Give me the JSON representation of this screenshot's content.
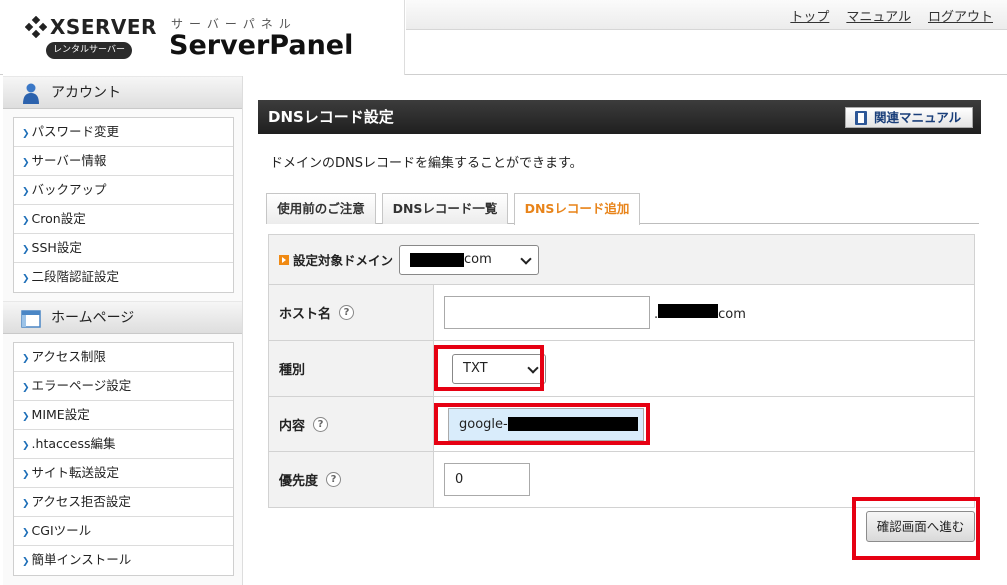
{
  "header": {
    "brand": "XSERVER",
    "rental_badge": "レンタルサーバー",
    "panel_kana": "サーバーパネル",
    "panel_name": "ServerPanel",
    "links": [
      "トップ",
      "マニュアル",
      "ログアウト"
    ]
  },
  "sidebar": {
    "sections": [
      {
        "title": "アカウント",
        "icon": "user-icon",
        "items": [
          "パスワード変更",
          "サーバー情報",
          "バックアップ",
          "Cron設定",
          "SSH設定",
          "二段階認証設定"
        ]
      },
      {
        "title": "ホームページ",
        "icon": "window-icon",
        "items": [
          "アクセス制限",
          "エラーページ設定",
          "MIME設定",
          ".htaccess編集",
          "サイト転送設定",
          "アクセス拒否設定",
          "CGIツール",
          "簡単インストール"
        ]
      }
    ]
  },
  "main": {
    "title": "DNSレコード設定",
    "manual_button": "関連マニュアル",
    "description": "ドメインのDNSレコードを編集することができます。",
    "tabs": [
      "使用前のご注意",
      "DNSレコード一覧",
      "DNSレコード追加"
    ],
    "active_tab": 2,
    "domain_label": "設定対象ドメイン",
    "domain_suffix": "com",
    "host_label": "ホスト名",
    "host_suffix": "com",
    "type_label": "種別",
    "type_value": "TXT",
    "content_label": "内容",
    "content_value": "google-",
    "priority_label": "優先度",
    "priority_value": "0",
    "help_mark": "?",
    "submit_button": "確認画面へ進む"
  },
  "colors": {
    "highlight_red": "#e60012",
    "active_tab_orange": "#e8841a",
    "title_bar": "#2a2a2a"
  }
}
